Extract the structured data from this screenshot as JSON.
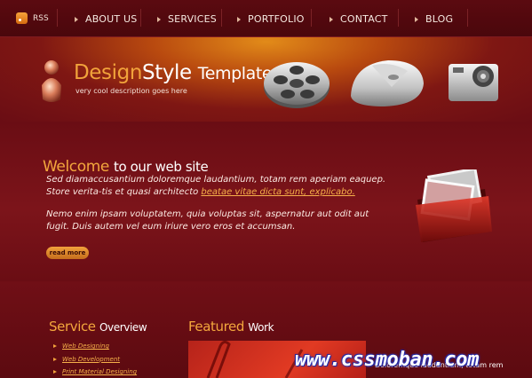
{
  "nav": {
    "rss_label": "RSS",
    "items": [
      "ABOUT US",
      "SERVICES",
      "PORTFOLIO",
      "CONTACT",
      "BLOG"
    ]
  },
  "header": {
    "logo_design": "Design",
    "logo_style": "Style",
    "logo_template": "Template",
    "tagline": "very cool description goes here"
  },
  "welcome": {
    "title_highlight": "Welcome",
    "title_rest": "to our web site",
    "p1_text": "Sed diamaccusantium doloremque laudantium, totam rem aperiam eaquep. Store verita-tis et quasi architecto ",
    "p1_link": "beatae vitae dicta sunt, explicabo.",
    "p2_text": "Nemo enim ipsam voluptatem, quia voluptas sit, aspernatur aut odit aut fugit. Duis autem vel eum iriure vero eros et accumsan.",
    "read_more": "read more"
  },
  "services": {
    "title_highlight": "Service",
    "title_rest": "Overview",
    "items": [
      "Web Designing",
      "Web Development",
      "Print Material Designing"
    ]
  },
  "featured": {
    "title_highlight": "Featured",
    "title_rest": "Work",
    "caption": "Doloremque laudantium, totam rem",
    "caption2": "...",
    "watermark": "www.cssmoban.com"
  },
  "colors": {
    "background": "#6a0d14",
    "accent": "#f3a73d",
    "link": "#f6b04a"
  }
}
